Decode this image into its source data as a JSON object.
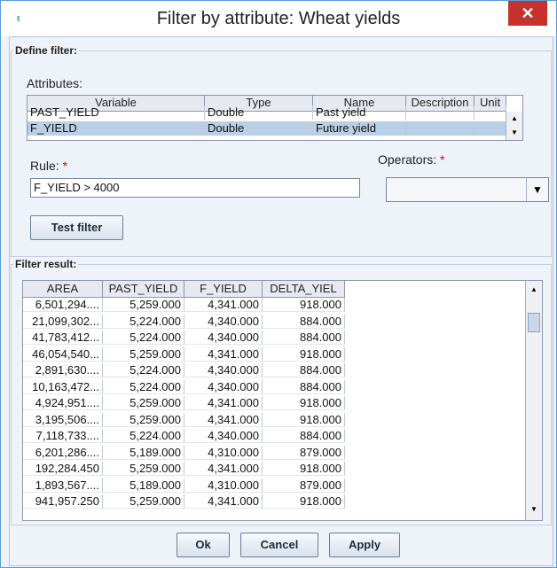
{
  "window": {
    "title": "Filter by attribute: Wheat yields",
    "app_icon_text": "fl.",
    "close_glyph": "✕"
  },
  "define": {
    "legend": "Define filter:",
    "attributes_label": "Attributes:",
    "columns": [
      "Variable",
      "Type",
      "Name",
      "Description",
      "Unit"
    ],
    "rows": [
      {
        "variable": "PAST_YIELD",
        "type": "Double",
        "name": "Past yield",
        "description": "",
        "unit": "",
        "selected": false
      },
      {
        "variable": "F_YIELD",
        "type": "Double",
        "name": "Future yield",
        "description": "",
        "unit": "",
        "selected": true
      }
    ],
    "rule_label": "Rule:",
    "rule_value": "F_YIELD > 4000",
    "operators_label": "Operators:",
    "operators_value": "",
    "required_mark": "*",
    "test_button": "Test filter"
  },
  "result": {
    "legend": "Filter result:",
    "columns": [
      "AREA",
      "PAST_YIELD",
      "F_YIELD",
      "DELTA_YIEL"
    ],
    "rows": [
      [
        "6,501,294....",
        "5,259.000",
        "4,341.000",
        "918.000"
      ],
      [
        "21,099,302...",
        "5,224.000",
        "4,340.000",
        "884.000"
      ],
      [
        "41,783,412...",
        "5,224.000",
        "4,340.000",
        "884.000"
      ],
      [
        "46,054,540...",
        "5,259.000",
        "4,341.000",
        "918.000"
      ],
      [
        "2,891,630....",
        "5,224.000",
        "4,340.000",
        "884.000"
      ],
      [
        "10,163,472...",
        "5,224.000",
        "4,340.000",
        "884.000"
      ],
      [
        "4,924,951....",
        "5,259.000",
        "4,341.000",
        "918.000"
      ],
      [
        "3,195,506....",
        "5,259.000",
        "4,341.000",
        "918.000"
      ],
      [
        "7,118,733....",
        "5,224.000",
        "4,340.000",
        "884.000"
      ],
      [
        "6,201,286....",
        "5,189.000",
        "4,310.000",
        "879.000"
      ],
      [
        "192,284.450",
        "5,259.000",
        "4,341.000",
        "918.000"
      ],
      [
        "1,893,567....",
        "5,189.000",
        "4,310.000",
        "879.000"
      ],
      [
        "941,957.250",
        "5,259.000",
        "4,341.000",
        "918.000"
      ]
    ]
  },
  "footer": {
    "ok": "Ok",
    "cancel": "Cancel",
    "apply": "Apply"
  }
}
